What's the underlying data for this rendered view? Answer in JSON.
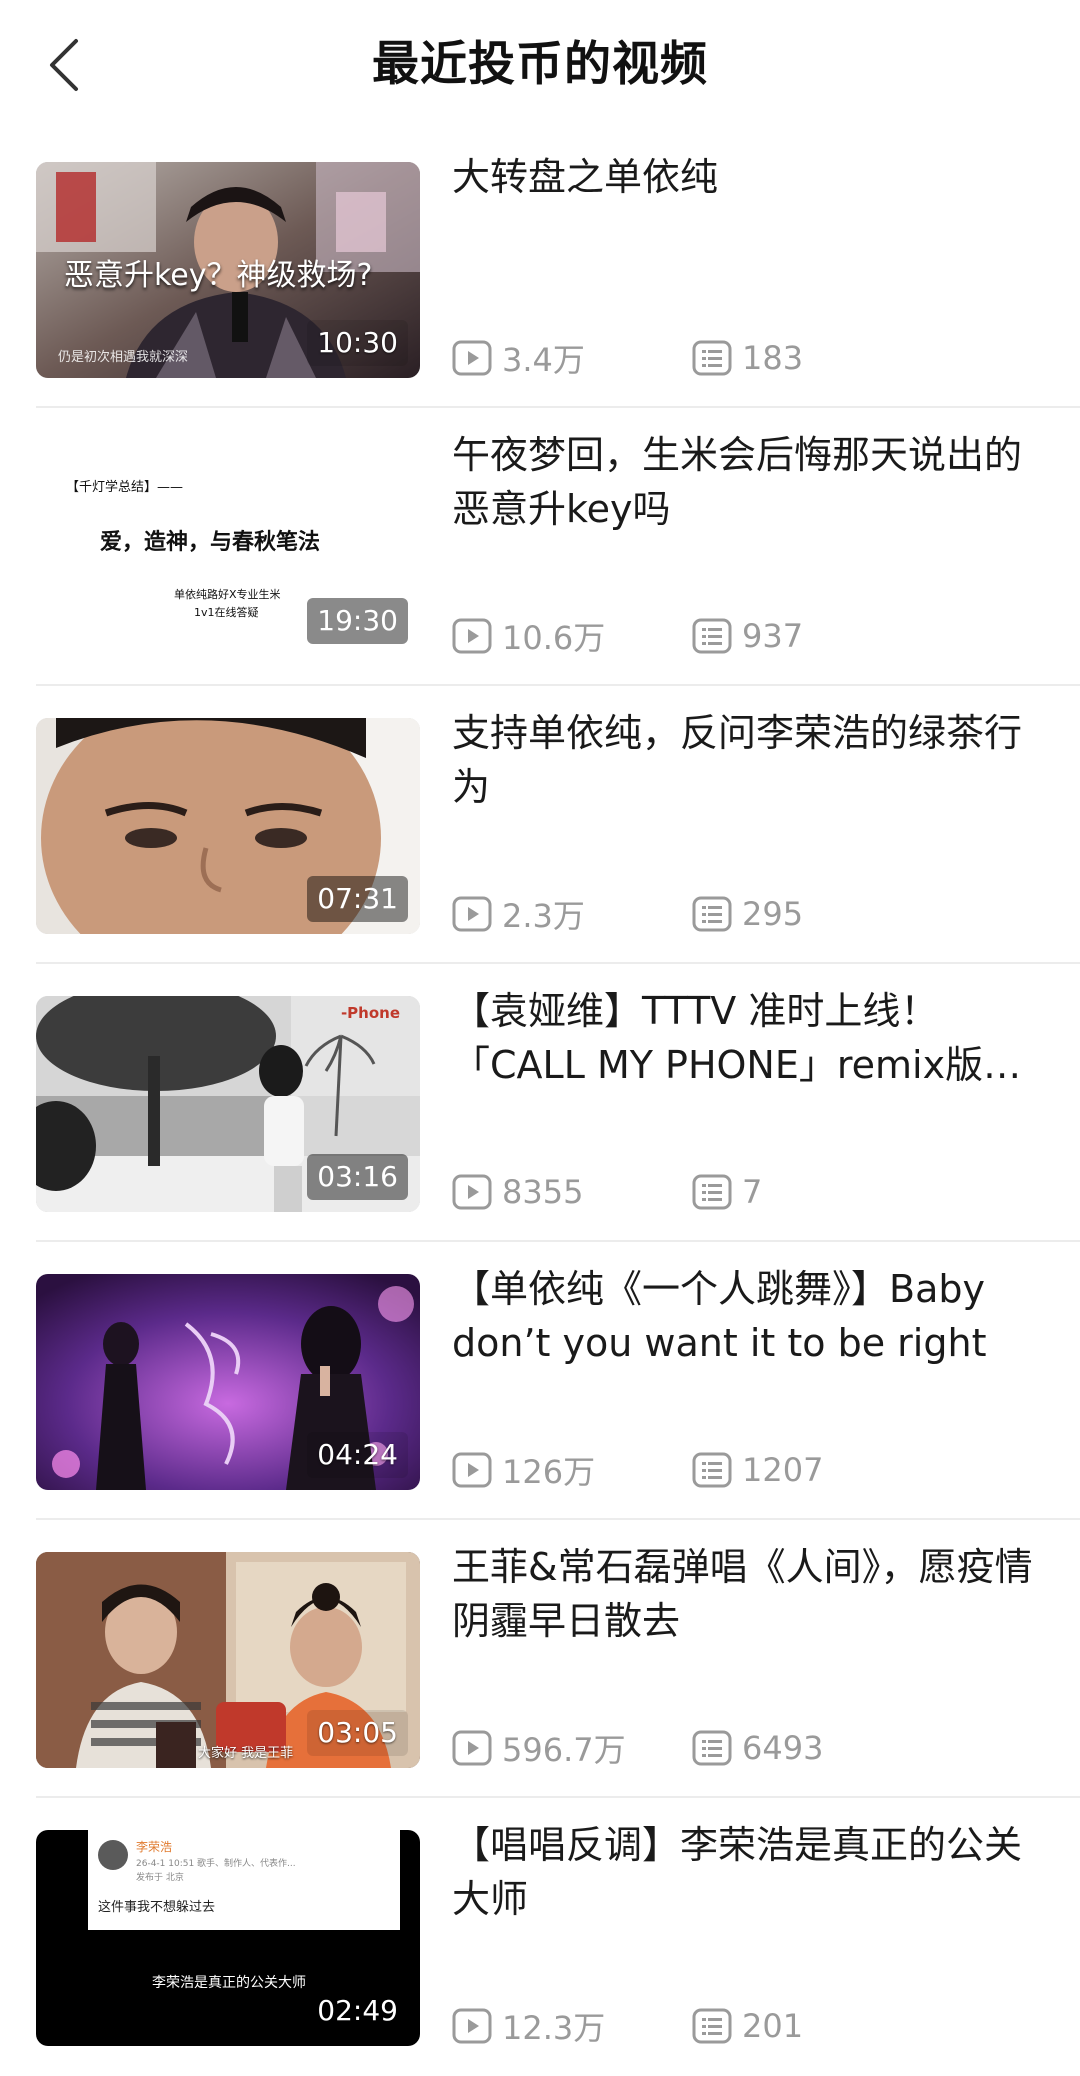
{
  "header": {
    "title": "最近投币的视频"
  },
  "videos": [
    {
      "title": "大转盘之单依纯",
      "duration": "10:30",
      "views": "3.4万",
      "comments": "183",
      "thumb_caption": "恶意升key？神级救场?",
      "thumb_subcaption": "仍是初次相遇我就深深"
    },
    {
      "title": "午夜梦回，生米会后悔那天说出的恶意升key吗",
      "duration": "19:30",
      "views": "10.6万",
      "comments": "937",
      "thumb_tag": "【千灯学总结】——",
      "thumb_headline": "爱，造神，与春秋笔法",
      "thumb_line1": "单依纯路好X专业生米",
      "thumb_line2": "1v1在线答疑"
    },
    {
      "title": "支持单依纯，反问李荣浩的绿茶行为",
      "duration": "07:31",
      "views": "2.3万",
      "comments": "295"
    },
    {
      "title": "【袁娅维】TTTV 准时上线！「CALL MY PHONE」remix版…",
      "duration": "03:16",
      "views": "8355",
      "comments": "7",
      "thumb_tag": "-Phone"
    },
    {
      "title": "【单依纯《一个人跳舞》】Baby don’t you want it to be right",
      "duration": "04:24",
      "views": "126万",
      "comments": "1207"
    },
    {
      "title": "王菲&常石磊弹唱《人间》，愿疫情阴霾早日散去",
      "duration": "03:05",
      "views": "596.7万",
      "comments": "6493",
      "thumb_caption": "大家好 我是王菲"
    },
    {
      "title": "【唱唱反调】李荣浩是真正的公关大师",
      "duration": "02:49",
      "views": "12.3万",
      "comments": "201",
      "thumb_name": "李荣浩",
      "thumb_meta": "26-4-1 10:51  歌手、制作人、代表作...",
      "thumb_loc": "发布于 北京",
      "thumb_post": "这件事我不想躲过去",
      "thumb_caption": "李荣浩是真正的公关大师"
    }
  ],
  "colors": {
    "accent": "#1a1a1a",
    "meta_gray": "#9a9a9a",
    "divider": "#ececec"
  },
  "icons": {
    "back": "chevron-left-icon",
    "views": "play-icon",
    "comments": "comment-icon"
  }
}
